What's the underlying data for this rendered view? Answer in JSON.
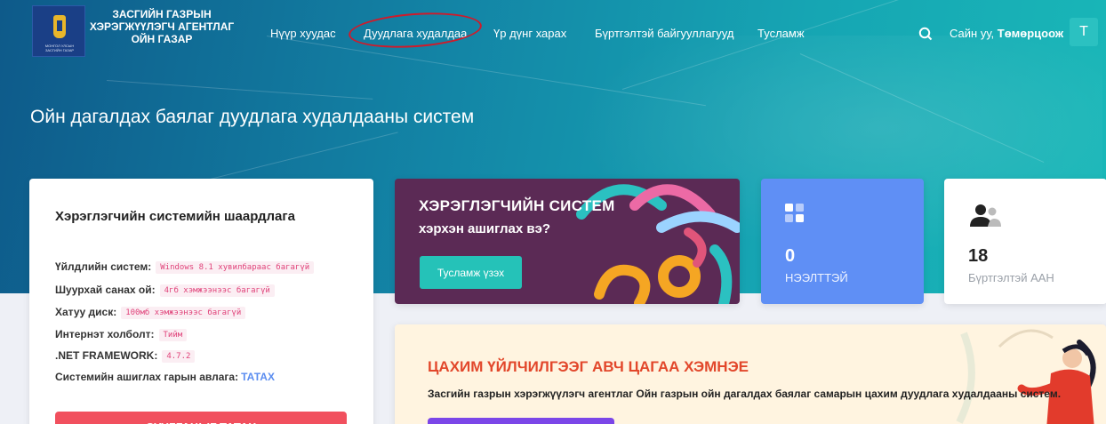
{
  "nav": {
    "org_name": "ЗАСГИЙН ГАЗРЫН ХЭРЭГЖҮҮЛЭГЧ АГЕНТЛАГ ОЙН ГАЗАР",
    "logo_caption": "МОНГОЛ УЛСЫН ЗАСГИЙН ГАЗАР",
    "links": [
      "Нүүр хуудас",
      "Дуудлага худалдаа",
      "Үр дүнг харах",
      "Бүртгэлтэй байгууллагууд",
      "Тусламж"
    ],
    "greeting_prefix": "Сайн уу,",
    "user_name": "Төмөрцоож",
    "avatar_letter": "T"
  },
  "hero": {
    "title": "Ойн дагалдах баялаг дуудлага худалдааны систем"
  },
  "requirements": {
    "title": "Хэрэглэгчийн системийн шаардлага",
    "rows": [
      {
        "label": "Үйлдлийн систем:",
        "value": "Windows 8.1 хувилбараас багагүй"
      },
      {
        "label": "Шуурхай санах ой:",
        "value": "4гб хэмжээнээс багагүй"
      },
      {
        "label": "Хатуу диск:",
        "value": "100мб хэмжээнээс багагүй"
      },
      {
        "label": "Интернэт холболт:",
        "value": "Тийм"
      },
      {
        "label": ".NET FRAMEWORK:",
        "value": "4.7.2"
      }
    ],
    "guide_label": "Системийн ашиглах гарын авлага:",
    "guide_link": "ТАТАХ",
    "download_button": "СУУЛГАЦЫГ ТАТАХ"
  },
  "promo": {
    "title": "ХЭРЭГЛЭГЧИЙН СИСТЕМ",
    "subtitle": "хэрхэн ашиглах вэ?",
    "button": "Тусламж үзэх"
  },
  "stats": [
    {
      "value": "0",
      "label": "НЭЭЛТТЭЙ",
      "icon": "grid-icon"
    },
    {
      "value": "18",
      "label": "Бүртгэлтэй ААН",
      "icon": "users-icon"
    }
  ],
  "banner": {
    "title": "ЦАХИМ ҮЙЛЧИЛГЭЭГ АВЧ ЦАГАА ХЭМНЭЕ",
    "text": "Засгийн газрын хэрэгжүүлэгч агентлаг Ойн газрын ойн дагалдах баялаг самарын цахим дуудлага худалдааны систем."
  },
  "colors": {
    "accent_teal": "#25c2b8",
    "stat_blue": "#5f8ff5",
    "danger": "#f1505e",
    "banner_title": "#e2472b",
    "annotation_circle": "#d01a2a"
  }
}
